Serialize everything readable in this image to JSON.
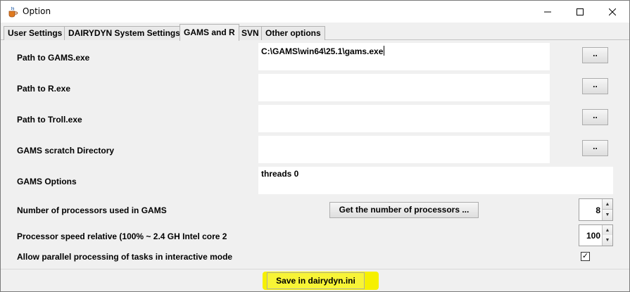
{
  "window": {
    "title": "Option",
    "minimize_glyph": "—",
    "close_glyph": "✕"
  },
  "tabs": [
    {
      "label": "User Settings",
      "active": false
    },
    {
      "label": "DAIRYDYN System Settings",
      "active": false
    },
    {
      "label": "GAMS and R",
      "active": true
    },
    {
      "label": "SVN",
      "active": false
    },
    {
      "label": "Other options",
      "active": false
    }
  ],
  "fields": {
    "gams_path": {
      "label": "Path to GAMS.exe",
      "value": "C:\\GAMS\\win64\\25.1\\gams.exe",
      "browse_label": ".."
    },
    "r_path": {
      "label": "Path to R.exe",
      "value": "",
      "browse_label": ".."
    },
    "troll_path": {
      "label": "Path to Troll.exe",
      "value": "",
      "browse_label": ".."
    },
    "scratch_dir": {
      "label": "GAMS scratch Directory",
      "value": "",
      "browse_label": ".."
    },
    "gams_options": {
      "label": "GAMS Options",
      "value": "threads 0"
    }
  },
  "processors": {
    "label": "Number of processors used in GAMS",
    "button_label": "Get the number of processors ...",
    "value": "8"
  },
  "speed": {
    "label": "Processor speed relative (100% ~ 2.4 GH Intel core 2",
    "value": "100"
  },
  "parallel": {
    "label": "Allow parallel processing of tasks in interactive mode",
    "checked": true,
    "check_glyph": "✓"
  },
  "footer": {
    "save_label": "Save in dairydyn.ini",
    "highlight_color": "#f6f000"
  },
  "icons": {
    "spin_up": "▲",
    "spin_down": "▼"
  }
}
